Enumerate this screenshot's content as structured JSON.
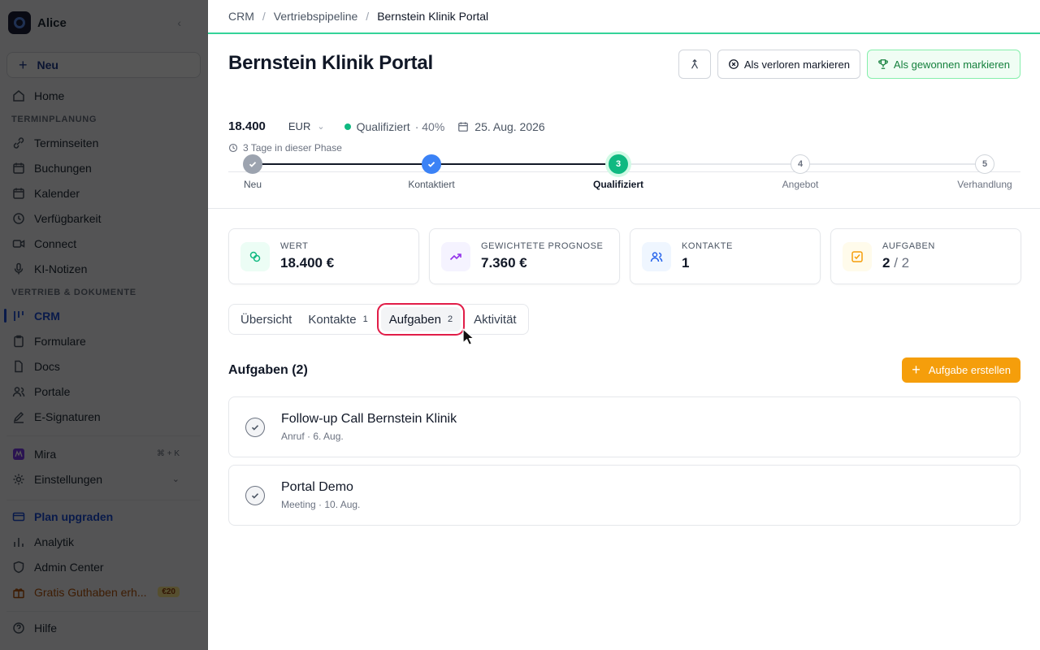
{
  "sidebar": {
    "workspace_name": "Alice",
    "new_label": "Neu",
    "home_label": "Home",
    "section_scheduling": "TERMINPLANUNG",
    "scheduling_items": [
      "Terminseiten",
      "Buchungen",
      "Kalender",
      "Verfügbarkeit",
      "Connect",
      "KI-Notizen"
    ],
    "section_sales": "VERTRIEB & DOKUMENTE",
    "sales_items": [
      "CRM",
      "Formulare",
      "Docs",
      "Portale",
      "E-Signaturen"
    ],
    "mira_label": "Mira",
    "mira_shortcut": "⌘ + K",
    "settings_label": "Einstellungen",
    "upgrade_label": "Plan upgraden",
    "analytics_label": "Analytik",
    "admin_label": "Admin Center",
    "credit_label": "Gratis Guthaben erh...",
    "credit_badge": "€20",
    "help_label": "Hilfe"
  },
  "breadcrumb": {
    "items": [
      "CRM",
      "Vertriebspipeline"
    ],
    "current": "Bernstein Klinik Portal",
    "separator": "/"
  },
  "deal": {
    "title": "Bernstein Klinik Portal",
    "amount": "18.400",
    "currency": "EUR",
    "stage": "Qualifiziert",
    "probability": "· 40%",
    "close_date": "25. Aug. 2026",
    "phase_duration": "3 Tage in dieser Phase"
  },
  "actions": {
    "lost_label": "Als verloren markieren",
    "won_label": "Als gewonnen markieren"
  },
  "stages": [
    {
      "label": "Neu",
      "number": "",
      "state": "done"
    },
    {
      "label": "Kontaktiert",
      "number": "",
      "state": "done"
    },
    {
      "label": "Qualifiziert",
      "number": "3",
      "state": "current"
    },
    {
      "label": "Angebot",
      "number": "4",
      "state": "todo"
    },
    {
      "label": "Verhandlung",
      "number": "5",
      "state": "todo"
    }
  ],
  "stats": [
    {
      "label": "WERT",
      "value": "18.400 €",
      "icon": "coins-icon",
      "color": "#10b981"
    },
    {
      "label": "GEWICHTETE PROGNOSE",
      "value": "7.360 €",
      "icon": "trend-up-icon",
      "color": "#9333ea"
    },
    {
      "label": "KONTAKTE",
      "value": "1",
      "icon": "users-icon",
      "color": "#2563eb"
    },
    {
      "label": "AUFGABEN",
      "value": "2",
      "value_suffix": " / 2",
      "icon": "checkbox-icon",
      "color": "#f59e0b"
    }
  ],
  "tabs": [
    {
      "label": "Übersicht",
      "count": ""
    },
    {
      "label": "Kontakte",
      "count": "1"
    },
    {
      "label": "Aufgaben",
      "count": "2"
    },
    {
      "label": "Aktivität",
      "count": ""
    }
  ],
  "tasks_section": {
    "heading": "Aufgaben (2)",
    "create_label": "Aufgabe erstellen"
  },
  "tasks": [
    {
      "title": "Follow-up Call Bernstein Klinik",
      "meta": "Anruf · 6. Aug."
    },
    {
      "title": "Portal Demo",
      "meta": "Meeting · 10. Aug."
    }
  ],
  "colors": {
    "accent_green": "#10b981",
    "accent_blue": "#3b82f6",
    "accent_orange": "#f59e0b",
    "highlight_red": "#e11d48"
  }
}
